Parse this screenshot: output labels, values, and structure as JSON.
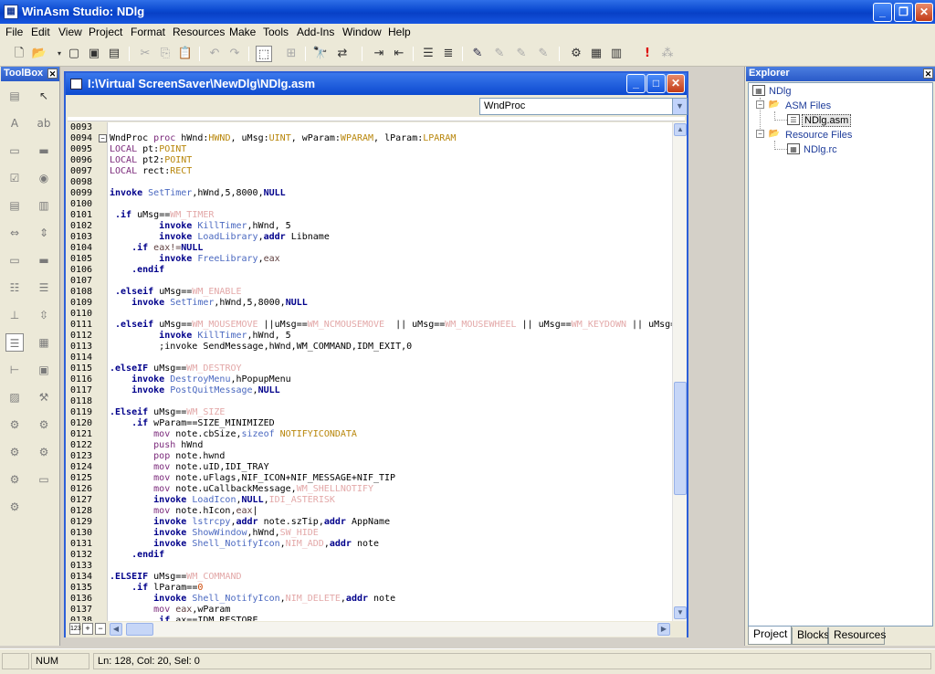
{
  "window": {
    "title": "WinAsm Studio: NDlg",
    "app_icon": "winasm-icon"
  },
  "menu": [
    "File",
    "Edit",
    "View",
    "Project",
    "Format",
    "Resources",
    "Make",
    "Tools",
    "Add-Ins",
    "Window",
    "Help"
  ],
  "toolbox": {
    "title": "ToolBox"
  },
  "editor": {
    "title": "I:\\Virtual ScreenSaver\\NewDlg\\NDlg.asm",
    "proc_selected": "WndProc",
    "line_numbers": [
      "0093",
      "0094",
      "0095",
      "0096",
      "0097",
      "0098",
      "0099",
      "0100",
      "0101",
      "0102",
      "0103",
      "0104",
      "0105",
      "0106",
      "0107",
      "0108",
      "0109",
      "0110",
      "0111",
      "0112",
      "0113",
      "0114",
      "0115",
      "0116",
      "0117",
      "0118",
      "0119",
      "0120",
      "0121",
      "0122",
      "0123",
      "0124",
      "0125",
      "0126",
      "0127",
      "0128",
      "0129",
      "0130",
      "0131",
      "0132",
      "0133",
      "0134",
      "0135",
      "0136",
      "0137",
      "0138"
    ],
    "lines": [
      [],
      [
        {
          "t": "WndProc ",
          "c": "blk"
        },
        {
          "t": "proc ",
          "c": "dr"
        },
        {
          "t": "hWnd:",
          "c": "blk"
        },
        {
          "t": "HWND",
          "c": "ty"
        },
        {
          "t": ", uMsg:",
          "c": "blk"
        },
        {
          "t": "UINT",
          "c": "ty"
        },
        {
          "t": ", wParam:",
          "c": "blk"
        },
        {
          "t": "WPARAM",
          "c": "ty"
        },
        {
          "t": ", lParam:",
          "c": "blk"
        },
        {
          "t": "LPARAM",
          "c": "ty"
        }
      ],
      [
        {
          "t": "LOCAL ",
          "c": "dr"
        },
        {
          "t": "pt:",
          "c": "blk"
        },
        {
          "t": "POINT",
          "c": "ty"
        }
      ],
      [
        {
          "t": "LOCAL ",
          "c": "dr"
        },
        {
          "t": "pt2:",
          "c": "blk"
        },
        {
          "t": "POINT",
          "c": "ty"
        }
      ],
      [
        {
          "t": "LOCAL ",
          "c": "dr"
        },
        {
          "t": "rect:",
          "c": "blk"
        },
        {
          "t": "RECT",
          "c": "ty"
        }
      ],
      [],
      [
        {
          "t": "invoke ",
          "c": "kw"
        },
        {
          "t": "SetTimer",
          "c": "fn"
        },
        {
          "t": ",hWnd,5,8000,",
          "c": "blk"
        },
        {
          "t": "NULL",
          "c": "kw"
        }
      ],
      [],
      [
        {
          "t": " .if ",
          "c": "kw"
        },
        {
          "t": "uMsg==",
          "c": "blk"
        },
        {
          "t": "WM_TIMER",
          "c": "ct"
        }
      ],
      [
        {
          "t": "         invoke ",
          "c": "kw"
        },
        {
          "t": "KillTimer",
          "c": "fn"
        },
        {
          "t": ",hWnd, 5",
          "c": "blk"
        }
      ],
      [
        {
          "t": "         invoke ",
          "c": "kw"
        },
        {
          "t": "LoadLibrary",
          "c": "fn"
        },
        {
          "t": ",",
          "c": "blk"
        },
        {
          "t": "addr ",
          "c": "kw"
        },
        {
          "t": "Libname",
          "c": "blk"
        }
      ],
      [
        {
          "t": "    .if ",
          "c": "kw"
        },
        {
          "t": "eax!=",
          "c": "rg"
        },
        {
          "t": "NULL",
          "c": "kw"
        }
      ],
      [
        {
          "t": "         invoke ",
          "c": "kw"
        },
        {
          "t": "FreeLibrary",
          "c": "fn"
        },
        {
          "t": ",",
          "c": "blk"
        },
        {
          "t": "eax",
          "c": "rg"
        }
      ],
      [
        {
          "t": "    .endif",
          "c": "kw"
        }
      ],
      [],
      [
        {
          "t": " .elseif ",
          "c": "kw"
        },
        {
          "t": "uMsg==",
          "c": "blk"
        },
        {
          "t": "WM_ENABLE",
          "c": "ct"
        }
      ],
      [
        {
          "t": "    invoke ",
          "c": "kw"
        },
        {
          "t": "SetTimer",
          "c": "fn"
        },
        {
          "t": ",hWnd,5,8000,",
          "c": "blk"
        },
        {
          "t": "NULL",
          "c": "kw"
        }
      ],
      [],
      [
        {
          "t": " .elseif ",
          "c": "kw"
        },
        {
          "t": "uMsg==",
          "c": "blk"
        },
        {
          "t": "WM_MOUSEMOVE",
          "c": "ct"
        },
        {
          "t": " ||uMsg==",
          "c": "blk"
        },
        {
          "t": "WM_NCMOUSEMOVE",
          "c": "ct"
        },
        {
          "t": "  || uMsg==",
          "c": "blk"
        },
        {
          "t": "WM_MOUSEWHEEL",
          "c": "ct"
        },
        {
          "t": " || uMsg==",
          "c": "blk"
        },
        {
          "t": "WM_KEYDOWN",
          "c": "ct"
        },
        {
          "t": " || uMsg=",
          "c": "blk"
        }
      ],
      [
        {
          "t": "         invoke ",
          "c": "kw"
        },
        {
          "t": "KillTimer",
          "c": "fn"
        },
        {
          "t": ",hWnd, 5",
          "c": "blk"
        }
      ],
      [
        {
          "t": "         ;invoke SendMessage,hWnd,WM_COMMAND,IDM_EXIT,0",
          "c": "blk"
        }
      ],
      [],
      [
        {
          "t": ".elseIF ",
          "c": "kw"
        },
        {
          "t": "uMsg==",
          "c": "blk"
        },
        {
          "t": "WM_DESTROY",
          "c": "ct"
        }
      ],
      [
        {
          "t": "    invoke ",
          "c": "kw"
        },
        {
          "t": "DestroyMenu",
          "c": "fn"
        },
        {
          "t": ",hPopupMenu",
          "c": "blk"
        }
      ],
      [
        {
          "t": "    invoke ",
          "c": "kw"
        },
        {
          "t": "PostQuitMessage",
          "c": "fn"
        },
        {
          "t": ",",
          "c": "blk"
        },
        {
          "t": "NULL",
          "c": "kw"
        }
      ],
      [],
      [
        {
          "t": ".Elseif ",
          "c": "kw"
        },
        {
          "t": "uMsg==",
          "c": "blk"
        },
        {
          "t": "WM_SIZE",
          "c": "ct"
        }
      ],
      [
        {
          "t": "    .if ",
          "c": "kw"
        },
        {
          "t": "wParam==SIZE_MINIMIZED",
          "c": "blk"
        }
      ],
      [
        {
          "t": "        mov ",
          "c": "dr"
        },
        {
          "t": "note.cbSize,",
          "c": "blk"
        },
        {
          "t": "sizeof ",
          "c": "fn"
        },
        {
          "t": "NOTIFYICONDATA",
          "c": "ty"
        }
      ],
      [
        {
          "t": "        push ",
          "c": "dr"
        },
        {
          "t": "hWnd",
          "c": "blk"
        }
      ],
      [
        {
          "t": "        pop ",
          "c": "dr"
        },
        {
          "t": "note.hwnd",
          "c": "blk"
        }
      ],
      [
        {
          "t": "        mov ",
          "c": "dr"
        },
        {
          "t": "note.uID,IDI_TRAY",
          "c": "blk"
        }
      ],
      [
        {
          "t": "        mov ",
          "c": "dr"
        },
        {
          "t": "note.uFlags,NIF_ICON+NIF_MESSAGE+NIF_TIP",
          "c": "blk"
        }
      ],
      [
        {
          "t": "        mov ",
          "c": "dr"
        },
        {
          "t": "note.uCallbackMessage,",
          "c": "blk"
        },
        {
          "t": "WM_SHELLNOTIFY",
          "c": "ct"
        }
      ],
      [
        {
          "t": "        invoke ",
          "c": "kw"
        },
        {
          "t": "LoadIcon",
          "c": "fn"
        },
        {
          "t": ",",
          "c": "blk"
        },
        {
          "t": "NULL",
          "c": "kw"
        },
        {
          "t": ",",
          "c": "blk"
        },
        {
          "t": "IDI_ASTERISK",
          "c": "ct"
        }
      ],
      [
        {
          "t": "        mov ",
          "c": "dr"
        },
        {
          "t": "note.hIcon,",
          "c": "blk"
        },
        {
          "t": "eax",
          "c": "rg"
        },
        {
          "t": "|",
          "c": "blk"
        }
      ],
      [
        {
          "t": "        invoke ",
          "c": "kw"
        },
        {
          "t": "lstrcpy",
          "c": "fn"
        },
        {
          "t": ",",
          "c": "blk"
        },
        {
          "t": "addr ",
          "c": "kw"
        },
        {
          "t": "note.szTip,",
          "c": "blk"
        },
        {
          "t": "addr ",
          "c": "kw"
        },
        {
          "t": "AppName",
          "c": "blk"
        }
      ],
      [
        {
          "t": "        invoke ",
          "c": "kw"
        },
        {
          "t": "ShowWindow",
          "c": "fn"
        },
        {
          "t": ",hWnd,",
          "c": "blk"
        },
        {
          "t": "SW_HIDE",
          "c": "ct"
        }
      ],
      [
        {
          "t": "        invoke ",
          "c": "kw"
        },
        {
          "t": "Shell_NotifyIcon",
          "c": "fn"
        },
        {
          "t": ",",
          "c": "blk"
        },
        {
          "t": "NIM_ADD",
          "c": "ct"
        },
        {
          "t": ",",
          "c": "blk"
        },
        {
          "t": "addr ",
          "c": "kw"
        },
        {
          "t": "note",
          "c": "blk"
        }
      ],
      [
        {
          "t": "    .endif",
          "c": "kw"
        }
      ],
      [],
      [
        {
          "t": ".ELSEIF ",
          "c": "kw"
        },
        {
          "t": "uMsg==",
          "c": "blk"
        },
        {
          "t": "WM_COMMAND",
          "c": "ct"
        }
      ],
      [
        {
          "t": "    .if ",
          "c": "kw"
        },
        {
          "t": "lParam==",
          "c": "blk"
        },
        {
          "t": "0",
          "c": "nm"
        }
      ],
      [
        {
          "t": "        invoke ",
          "c": "kw"
        },
        {
          "t": "Shell_NotifyIcon",
          "c": "fn"
        },
        {
          "t": ",",
          "c": "blk"
        },
        {
          "t": "NIM_DELETE",
          "c": "ct"
        },
        {
          "t": ",",
          "c": "blk"
        },
        {
          "t": "addr ",
          "c": "kw"
        },
        {
          "t": "note",
          "c": "blk"
        }
      ],
      [
        {
          "t": "        mov ",
          "c": "dr"
        },
        {
          "t": "eax",
          "c": "rg"
        },
        {
          "t": ",wParam",
          "c": "blk"
        }
      ],
      [
        {
          "t": "        .if ",
          "c": "kw"
        },
        {
          "t": "ax==IDM_RESTORE",
          "c": "blk"
        }
      ]
    ]
  },
  "explorer": {
    "title": "Explorer",
    "root": "NDlg",
    "asm_group": "ASM Files",
    "asm_file": "NDlg.asm",
    "res_group": "Resource Files",
    "res_file": "NDlg.rc",
    "tabs": [
      "Project",
      "Blocks",
      "Resources"
    ]
  },
  "status": {
    "num": "NUM",
    "position": "Ln: 128, Col: 20, Sel: 0"
  }
}
